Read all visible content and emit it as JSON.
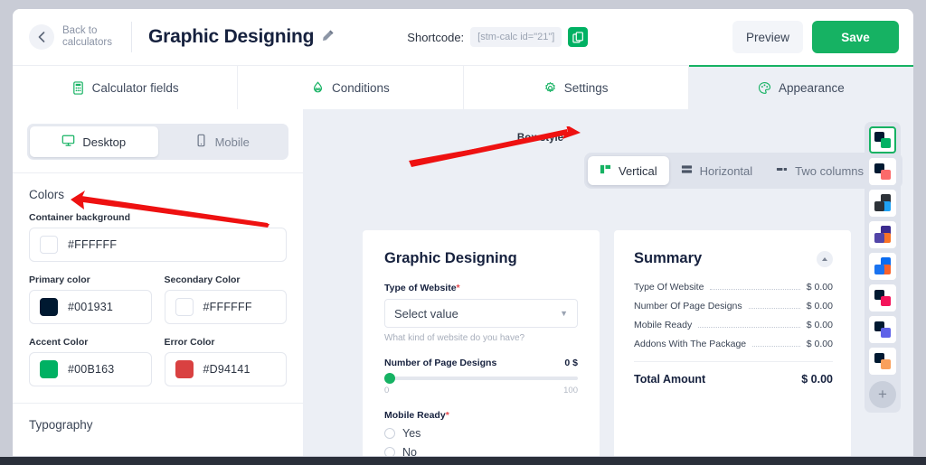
{
  "header": {
    "back_label": "Back to calculators",
    "title": "Graphic Designing",
    "edit_icon": "pencil-icon",
    "shortcode_label": "Shortcode:",
    "shortcode_value": "[stm-calc id=\"21\"]",
    "copy_icon": "copy-icon",
    "preview_label": "Preview",
    "save_label": "Save",
    "accent_color": "#16b263"
  },
  "tabs": [
    {
      "label": "Calculator fields",
      "icon": "calculator-icon",
      "active": false
    },
    {
      "label": "Conditions",
      "icon": "conditions-icon",
      "active": false
    },
    {
      "label": "Settings",
      "icon": "gear-icon",
      "active": false
    },
    {
      "label": "Appearance",
      "icon": "palette-icon",
      "active": true
    }
  ],
  "sidebar": {
    "device_toggle": [
      {
        "label": "Desktop",
        "icon": "monitor-icon",
        "active": true
      },
      {
        "label": "Mobile",
        "icon": "phone-icon",
        "active": false
      }
    ],
    "colors_section_title": "Colors",
    "fields": {
      "container_background": {
        "label": "Container background",
        "value": "#FFFFFF",
        "color": "#FFFFFF"
      },
      "primary_color": {
        "label": "Primary color",
        "value": "#001931",
        "color": "#001931"
      },
      "secondary_color": {
        "label": "Secondary Color",
        "value": "#FFFFFF",
        "color": "#FFFFFF"
      },
      "accent_color": {
        "label": "Accent Color",
        "value": "#00B163",
        "color": "#00B163"
      },
      "error_color": {
        "label": "Error Color",
        "value": "#D94141",
        "color": "#D94141"
      }
    },
    "typography_title": "Typography"
  },
  "main": {
    "box_style_label": "Box style",
    "box_styles": [
      {
        "label": "Vertical",
        "icon": "vertical-layout-icon",
        "active": true
      },
      {
        "label": "Horizontal",
        "icon": "horizontal-layout-icon",
        "active": false
      },
      {
        "label": "Two columns",
        "icon": "two-columns-icon",
        "active": false
      }
    ],
    "form_card": {
      "title": "Graphic Designing",
      "type_of_website": {
        "label": "Type of Website",
        "required_marker": "*",
        "placeholder": "Select value",
        "hint": "What kind of website do you have?"
      },
      "page_designs": {
        "label": "Number of Page Designs",
        "value": "0 $",
        "min": "0",
        "max": "100",
        "position_percent": 0
      },
      "mobile_ready": {
        "label": "Mobile Ready",
        "required_marker": "*",
        "options": [
          {
            "label": "Yes",
            "selected": false
          },
          {
            "label": "No",
            "selected": false
          }
        ]
      }
    },
    "summary_card": {
      "title": "Summary",
      "collapse_icon": "chevron-up-icon",
      "rows": [
        {
          "name": "Type Of Website",
          "price": "$ 0.00"
        },
        {
          "name": "Number Of Page Designs",
          "price": "$ 0.00"
        },
        {
          "name": "Mobile Ready",
          "price": "$ 0.00"
        },
        {
          "name": "Addons With The Package",
          "price": "$ 0.00"
        }
      ],
      "total_label": "Total Amount",
      "total_value": "$ 0.00"
    }
  },
  "palette": {
    "themes": [
      {
        "primary": "#001931",
        "accent": "#00b163",
        "selected": true
      },
      {
        "primary": "#001931",
        "accent": "#fb6a6a",
        "selected": false
      },
      {
        "primary": "#2d3238",
        "accent": "#1fa2f5",
        "selected": false,
        "tl_alt": "#111111"
      },
      {
        "primary": "#5245a8",
        "accent": "#f97326",
        "selected": false,
        "tl_alt": "#3c2b8f"
      },
      {
        "primary": "#1a73f0",
        "accent": "#f9622a",
        "selected": false,
        "tl_alt": "#0a6cf0"
      },
      {
        "primary": "#001931",
        "accent": "#f4145b",
        "selected": false
      },
      {
        "primary": "#001931",
        "accent": "#5f62e8",
        "selected": false
      },
      {
        "primary": "#001931",
        "accent": "#f9a05c",
        "selected": false
      }
    ],
    "add_label": "+"
  },
  "annotations": [
    {
      "name": "arrow-to-colors",
      "points_to": "Colors"
    },
    {
      "name": "arrow-to-box-style",
      "points_to": "Box style"
    }
  ]
}
